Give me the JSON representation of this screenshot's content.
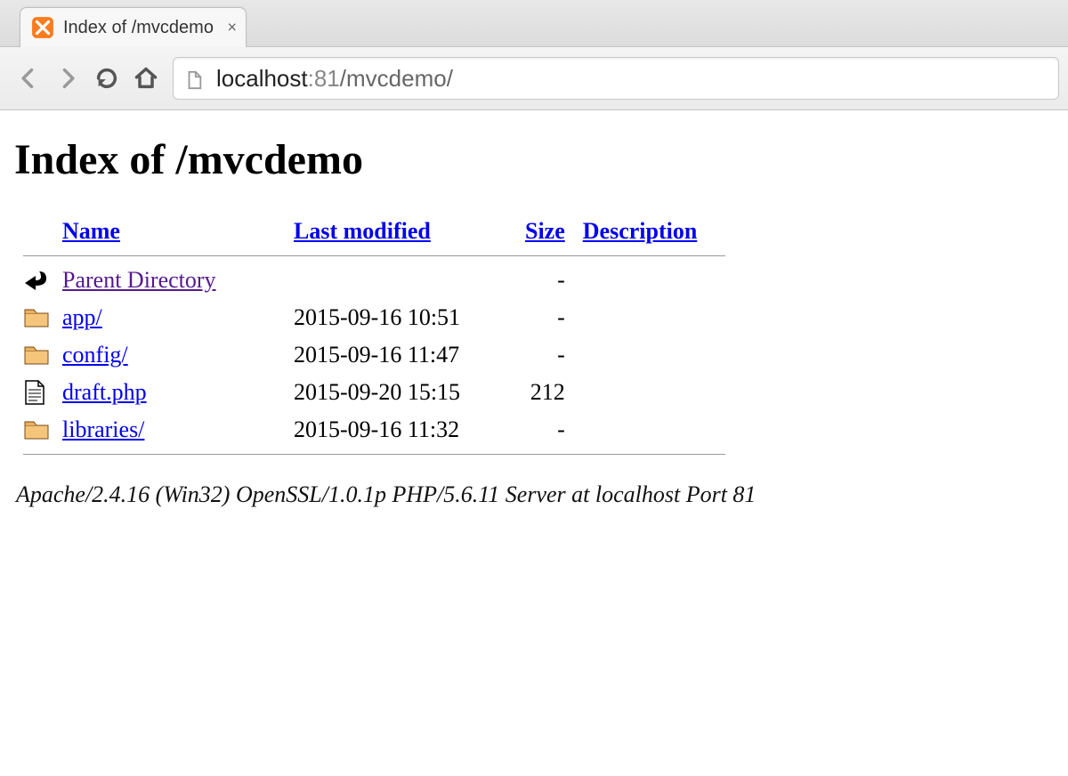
{
  "browser": {
    "tab_title": "Index of /mvcdemo",
    "url_host": "localhost",
    "url_port": ":81",
    "url_path": "/mvcdemo/"
  },
  "page": {
    "heading": "Index of /mvcdemo",
    "columns": {
      "name": "Name",
      "modified": "Last modified",
      "size": "Size",
      "description": "Description"
    },
    "parent": {
      "label": "Parent Directory",
      "modified": "",
      "size": "-",
      "description": ""
    },
    "rows": [
      {
        "icon": "folder",
        "name": "app/",
        "modified": "2015-09-16 10:51",
        "size": "-",
        "description": ""
      },
      {
        "icon": "folder",
        "name": "config/",
        "modified": "2015-09-16 11:47",
        "size": "-",
        "description": ""
      },
      {
        "icon": "file",
        "name": "draft.php",
        "modified": "2015-09-20 15:15",
        "size": "212",
        "description": ""
      },
      {
        "icon": "folder",
        "name": "libraries/",
        "modified": "2015-09-16 11:32",
        "size": "-",
        "description": ""
      }
    ],
    "server_signature": "Apache/2.4.16 (Win32) OpenSSL/1.0.1p PHP/5.6.11 Server at localhost Port 81"
  }
}
